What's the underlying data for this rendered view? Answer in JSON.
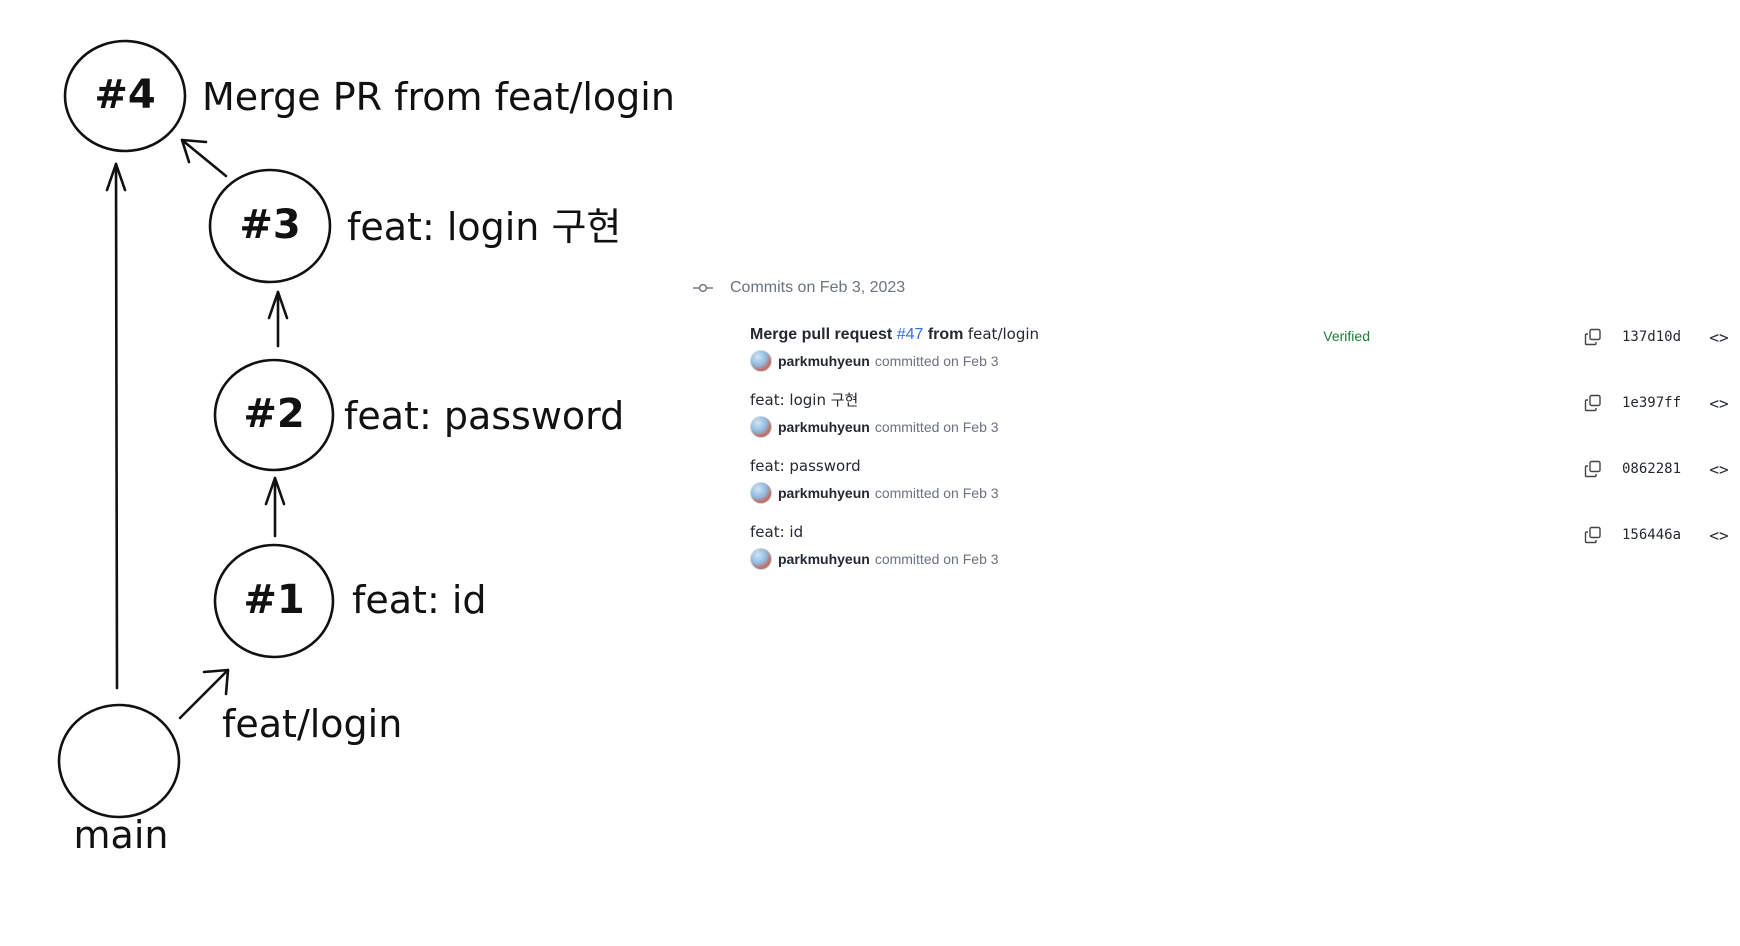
{
  "diagram": {
    "nodes": [
      {
        "id": "n4",
        "label": "#4",
        "message": "Merge PR from feat/login"
      },
      {
        "id": "n3",
        "label": "#3",
        "message": "feat: login 구현"
      },
      {
        "id": "n2",
        "label": "#2",
        "message": "feat: password"
      },
      {
        "id": "n1",
        "label": "#1",
        "message": "feat: id"
      },
      {
        "id": "main",
        "label": "",
        "message": "main"
      }
    ],
    "branch_label": "feat/login"
  },
  "commits_panel": {
    "header": "Commits on Feb 3, 2023",
    "commits": [
      {
        "title_prefix": "Merge pull request ",
        "pr_link": "#47",
        "title_suffix": " from ",
        "branch": "feat/login",
        "author": "parkmuhyeun",
        "meta": "committed on Feb 3",
        "verified": "Verified",
        "sha": "137d10d"
      },
      {
        "title": "feat: login 구현",
        "author": "parkmuhyeun",
        "meta": "committed on Feb 3",
        "sha": "1e397ff"
      },
      {
        "title": "feat: password",
        "author": "parkmuhyeun",
        "meta": "committed on Feb 3",
        "sha": "0862281"
      },
      {
        "title": "feat: id",
        "author": "parkmuhyeun",
        "meta": "committed on Feb 3",
        "sha": "156446a"
      }
    ],
    "icons": {
      "commit": "git-commit-icon",
      "copy": "copy-icon",
      "browse": "code-browse-icon"
    },
    "colors": {
      "link": "#2f6fdb",
      "verified": "#1a7f37",
      "muted": "#6b7280"
    }
  }
}
